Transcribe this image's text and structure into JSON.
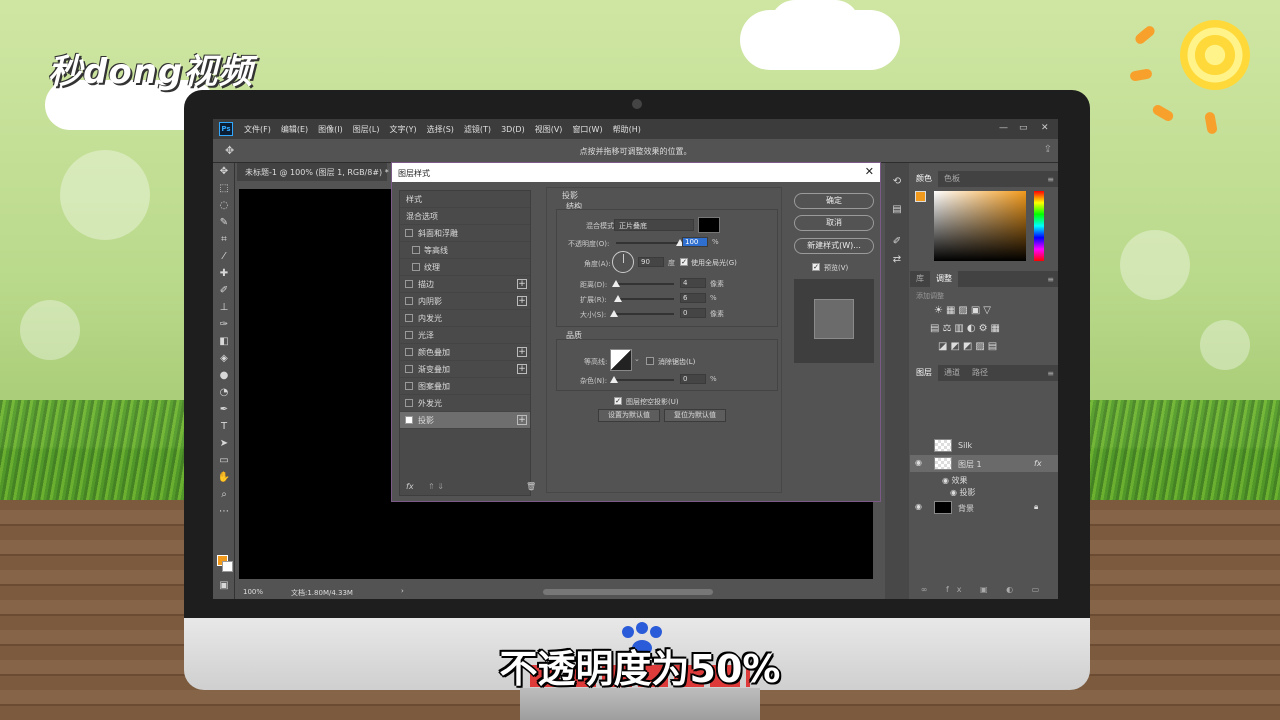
{
  "brand": {
    "logo_text": "秒dong视频"
  },
  "subtitle": "不透明度为50%",
  "menubar": {
    "app_icon": "Ps",
    "items": [
      "文件(F)",
      "编辑(E)",
      "图像(I)",
      "图层(L)",
      "文字(Y)",
      "选择(S)",
      "滤镜(T)",
      "3D(D)",
      "视图(V)",
      "窗口(W)",
      "帮助(H)"
    ]
  },
  "options_bar": {
    "hint": "点按并拖移可调整效果的位置。"
  },
  "document": {
    "tab_title": "未标题-1 @ 100% (图层 1, RGB/8#) *",
    "tab_close": "×",
    "zoom": "100%",
    "doc_info": "文档:1.80M/4.33M"
  },
  "dialog": {
    "title": "图层样式",
    "styles": [
      {
        "label": "样式",
        "checkbox": false,
        "checked": false,
        "plus": false,
        "indent": false
      },
      {
        "label": "混合选项",
        "checkbox": false,
        "checked": false,
        "plus": false,
        "indent": false
      },
      {
        "label": "斜面和浮雕",
        "checkbox": true,
        "checked": false,
        "plus": false,
        "indent": false
      },
      {
        "label": "等高线",
        "checkbox": true,
        "checked": false,
        "plus": false,
        "indent": true
      },
      {
        "label": "纹理",
        "checkbox": true,
        "checked": false,
        "plus": false,
        "indent": true
      },
      {
        "label": "描边",
        "checkbox": true,
        "checked": false,
        "plus": true,
        "indent": false
      },
      {
        "label": "内阴影",
        "checkbox": true,
        "checked": false,
        "plus": true,
        "indent": false
      },
      {
        "label": "内发光",
        "checkbox": true,
        "checked": false,
        "plus": false,
        "indent": false
      },
      {
        "label": "光泽",
        "checkbox": true,
        "checked": false,
        "plus": false,
        "indent": false
      },
      {
        "label": "颜色叠加",
        "checkbox": true,
        "checked": false,
        "plus": true,
        "indent": false
      },
      {
        "label": "渐变叠加",
        "checkbox": true,
        "checked": false,
        "plus": true,
        "indent": false
      },
      {
        "label": "图案叠加",
        "checkbox": true,
        "checked": false,
        "plus": false,
        "indent": false
      },
      {
        "label": "外发光",
        "checkbox": true,
        "checked": false,
        "plus": false,
        "indent": false
      },
      {
        "label": "投影",
        "checkbox": true,
        "checked": true,
        "plus": true,
        "indent": false,
        "selected": true
      }
    ],
    "footer_fx": "fx",
    "section_title": "投影",
    "structure": {
      "title": "结构",
      "blend_mode_label": "混合模式:",
      "blend_mode_value": "正片叠底",
      "opacity_label": "不透明度(O):",
      "opacity_value": "100",
      "opacity_level": 100,
      "percent": "%",
      "angle_label": "角度(A):",
      "angle_value": "90",
      "degree": "度",
      "global_light_label": "使用全局光(G)",
      "global_light_checked": true,
      "distance_label": "距离(D):",
      "distance_value": "4",
      "spread_label": "扩展(R):",
      "spread_value": "6",
      "size_label": "大小(S):",
      "size_value": "0",
      "pixel_unit": "像素"
    },
    "quality": {
      "title": "品质",
      "contour_label": "等高线:",
      "antialias_label": "消除锯齿(L)",
      "antialias_checked": false,
      "noise_label": "杂色(N):",
      "noise_value": "0",
      "knockout_label": "图层挖空投影(U)",
      "knockout_checked": true
    },
    "buttons": {
      "make_default": "设置为默认值",
      "reset_default": "复位为默认值",
      "ok": "确定",
      "cancel": "取消",
      "new_style": "新建样式(W)...",
      "preview_label": "预览(V)",
      "preview_checked": true
    }
  },
  "panels": {
    "color_tabs": [
      "颜色",
      "色板"
    ],
    "adjust_tabs": [
      "库",
      "调整"
    ],
    "adjust_title": "添加调整",
    "layers_tabs": [
      "图层",
      "通道",
      "路径"
    ],
    "layers": [
      {
        "name": "Silk",
        "visible": false,
        "selected": false
      },
      {
        "name": "图层 1",
        "visible": true,
        "selected": true,
        "fx": "fx"
      },
      {
        "name": "背景",
        "visible": true,
        "selected": false
      }
    ],
    "effects_label": "效果",
    "effect_item": "投影"
  }
}
